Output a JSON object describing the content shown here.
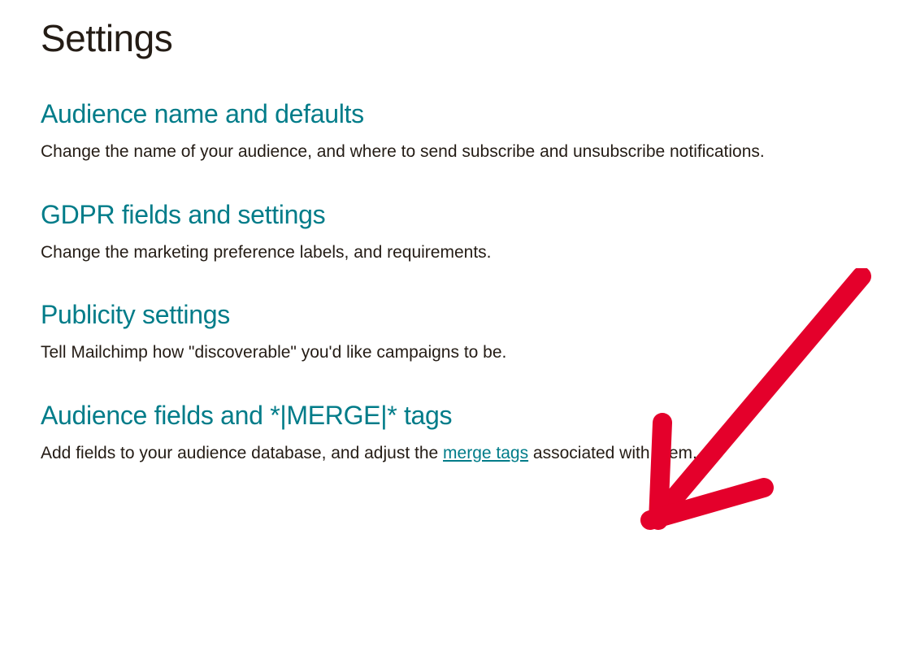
{
  "page": {
    "title": "Settings"
  },
  "sections": [
    {
      "heading": "Audience name and defaults",
      "description": "Change the name of your audience, and where to send subscribe and unsubscribe notifications."
    },
    {
      "heading": "GDPR fields and settings",
      "description": "Change the marketing preference labels, and requirements."
    },
    {
      "heading": "Publicity settings",
      "description": "Tell Mailchimp how \"discoverable\" you'd like campaigns to be."
    },
    {
      "heading": "Audience fields and *|MERGE|* tags",
      "description_prefix": "Add fields to your audience database, and adjust the ",
      "description_link": "merge tags",
      "description_suffix": " associated with them."
    }
  ],
  "annotation": {
    "type": "arrow",
    "color": "#e4002b"
  }
}
